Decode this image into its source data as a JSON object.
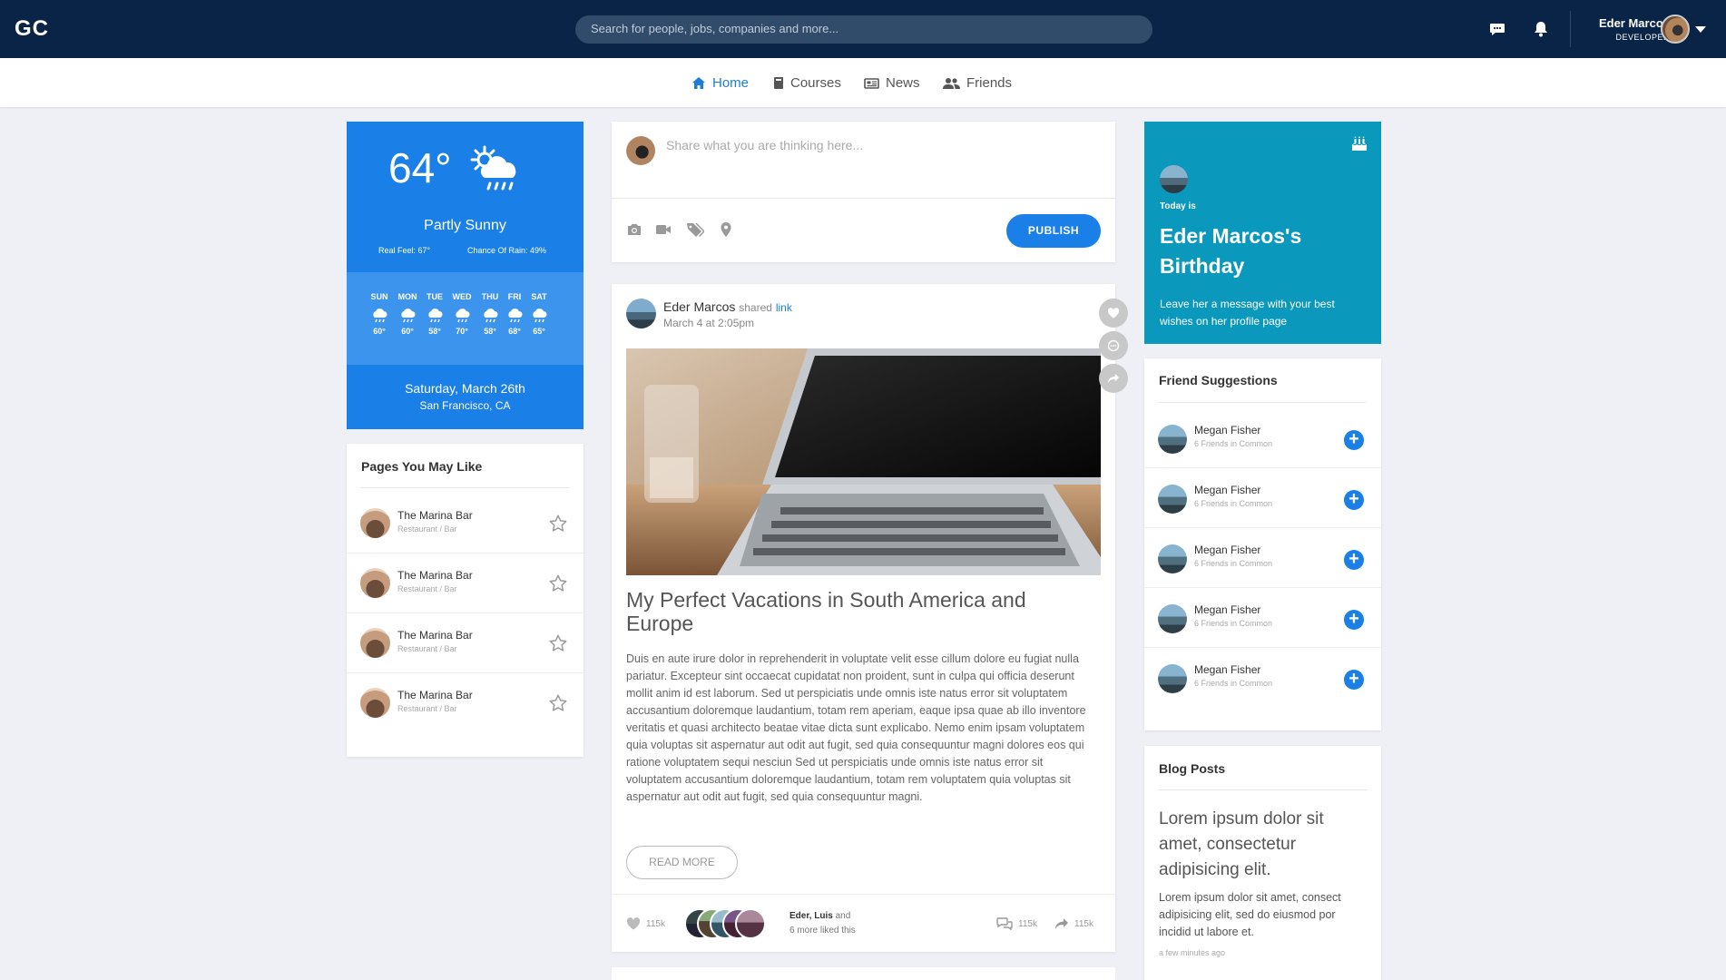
{
  "header": {
    "logo": "GC",
    "search_placeholder": "Search for people, jobs, companies and more...",
    "user_name": "Eder Marcos",
    "user_role": "DEVELOPER"
  },
  "nav": {
    "home": "Home",
    "courses": "Courses",
    "news": "News",
    "friends": "Friends"
  },
  "weather": {
    "temp": "64°",
    "condition": "Partly Sunny",
    "real_feel": "Real Feel: 67°",
    "chance_rain": "Chance Of Rain: 49%",
    "days": [
      {
        "day": "SUN",
        "temp": "60°"
      },
      {
        "day": "MON",
        "temp": "60°"
      },
      {
        "day": "TUE",
        "temp": "58°"
      },
      {
        "day": "WED",
        "temp": "70°"
      },
      {
        "day": "THU",
        "temp": "58°"
      },
      {
        "day": "FRI",
        "temp": "68°"
      },
      {
        "day": "SAT",
        "temp": "65°"
      }
    ],
    "date": "Saturday, March 26th",
    "location": "San Francisco, CA"
  },
  "pages": {
    "title": "Pages You May Like",
    "items": [
      {
        "name": "The Marina Bar",
        "sub": "Restaurant / Bar"
      },
      {
        "name": "The Marina Bar",
        "sub": "Restaurant / Bar"
      },
      {
        "name": "The Marina Bar",
        "sub": "Restaurant / Bar"
      },
      {
        "name": "The Marina Bar",
        "sub": "Restaurant / Bar"
      }
    ]
  },
  "share": {
    "placeholder": "Share what you are thinking here...",
    "publish": "PUBLISH"
  },
  "post": {
    "author": "Eder Marcos",
    "shared": "shared",
    "link": "link",
    "date": "March 4 at 2:05pm",
    "title": "My Perfect Vacations in South America and Europe",
    "body": "Duis en aute irure dolor in reprehenderit in voluptate velit esse cillum dolore eu fugiat nulla pariatur. Excepteur sint occaecat cupidatat non proident, sunt in culpa qui officia deserunt mollit anim id est laborum. Sed ut perspiciatis unde omnis iste natus error sit voluptatem accusantium doloremque laudantium, totam rem aperiam, eaque ipsa quae ab illo inventore veritatis et quasi architecto beatae vitae dicta sunt explicabo. Nemo enim ipsam voluptatem quia voluptas sit aspernatur aut odit aut fugit, sed quia consequuntur magni dolores eos qui ratione voluptatem sequi nesciun Sed ut perspiciatis unde omnis iste natus error sit voluptatem accusantium doloremque laudantium, totam rem voluptatem quia voluptas sit aspernatur aut odit aut fugit, sed quia consequuntur magni.",
    "read_more": "READ MORE",
    "likes": "115k",
    "liked_names": "Eder, Luis",
    "liked_and": "and",
    "liked_more": "6 more liked this",
    "comments": "115k",
    "shares": "115k"
  },
  "birthday": {
    "today": "Today is",
    "name": "Eder Marcos's Birthday",
    "message": "Leave her a message with your best wishes on her profile page"
  },
  "friends": {
    "title": "Friend Suggestions",
    "items": [
      {
        "name": "Megan Fisher",
        "sub": "6 Friends in Common"
      },
      {
        "name": "Megan Fisher",
        "sub": "6 Friends in Common"
      },
      {
        "name": "Megan Fisher",
        "sub": "6 Friends in Common"
      },
      {
        "name": "Megan Fisher",
        "sub": "6 Friends in Common"
      },
      {
        "name": "Megan Fisher",
        "sub": "6 Friends in Common"
      }
    ]
  },
  "blog": {
    "title": "Blog Posts",
    "heading": "Lorem ipsum dolor sit amet, consectetur adipisicing elit.",
    "body": "Lorem ipsum dolor sit amet, consect adipisicing elit, sed do eiusmod por incidid ut labore et.",
    "time": "a few minutes ago"
  },
  "colors": {
    "topbar": "#0a2447",
    "accent": "#1a7fe6",
    "birthday": "#0a98bd"
  }
}
